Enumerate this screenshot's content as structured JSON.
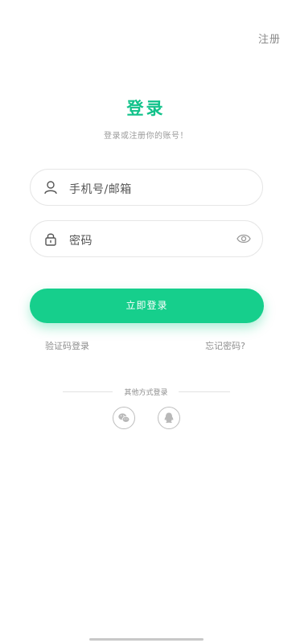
{
  "header": {
    "register_label": "注册"
  },
  "login": {
    "title": "登录",
    "subtitle": "登录或注册你的账号！",
    "account_placeholder": "手机号/邮箱",
    "password_placeholder": "密码",
    "submit_label": "立即登录",
    "sms_login_label": "验证码登录",
    "forgot_password_label": "忘记密码?"
  },
  "other_login": {
    "label": "其他方式登录",
    "providers": [
      {
        "name": "wechat-icon"
      },
      {
        "name": "qq-icon"
      }
    ]
  },
  "colors": {
    "accent": "#12c28a",
    "button": "#16cf8c"
  }
}
